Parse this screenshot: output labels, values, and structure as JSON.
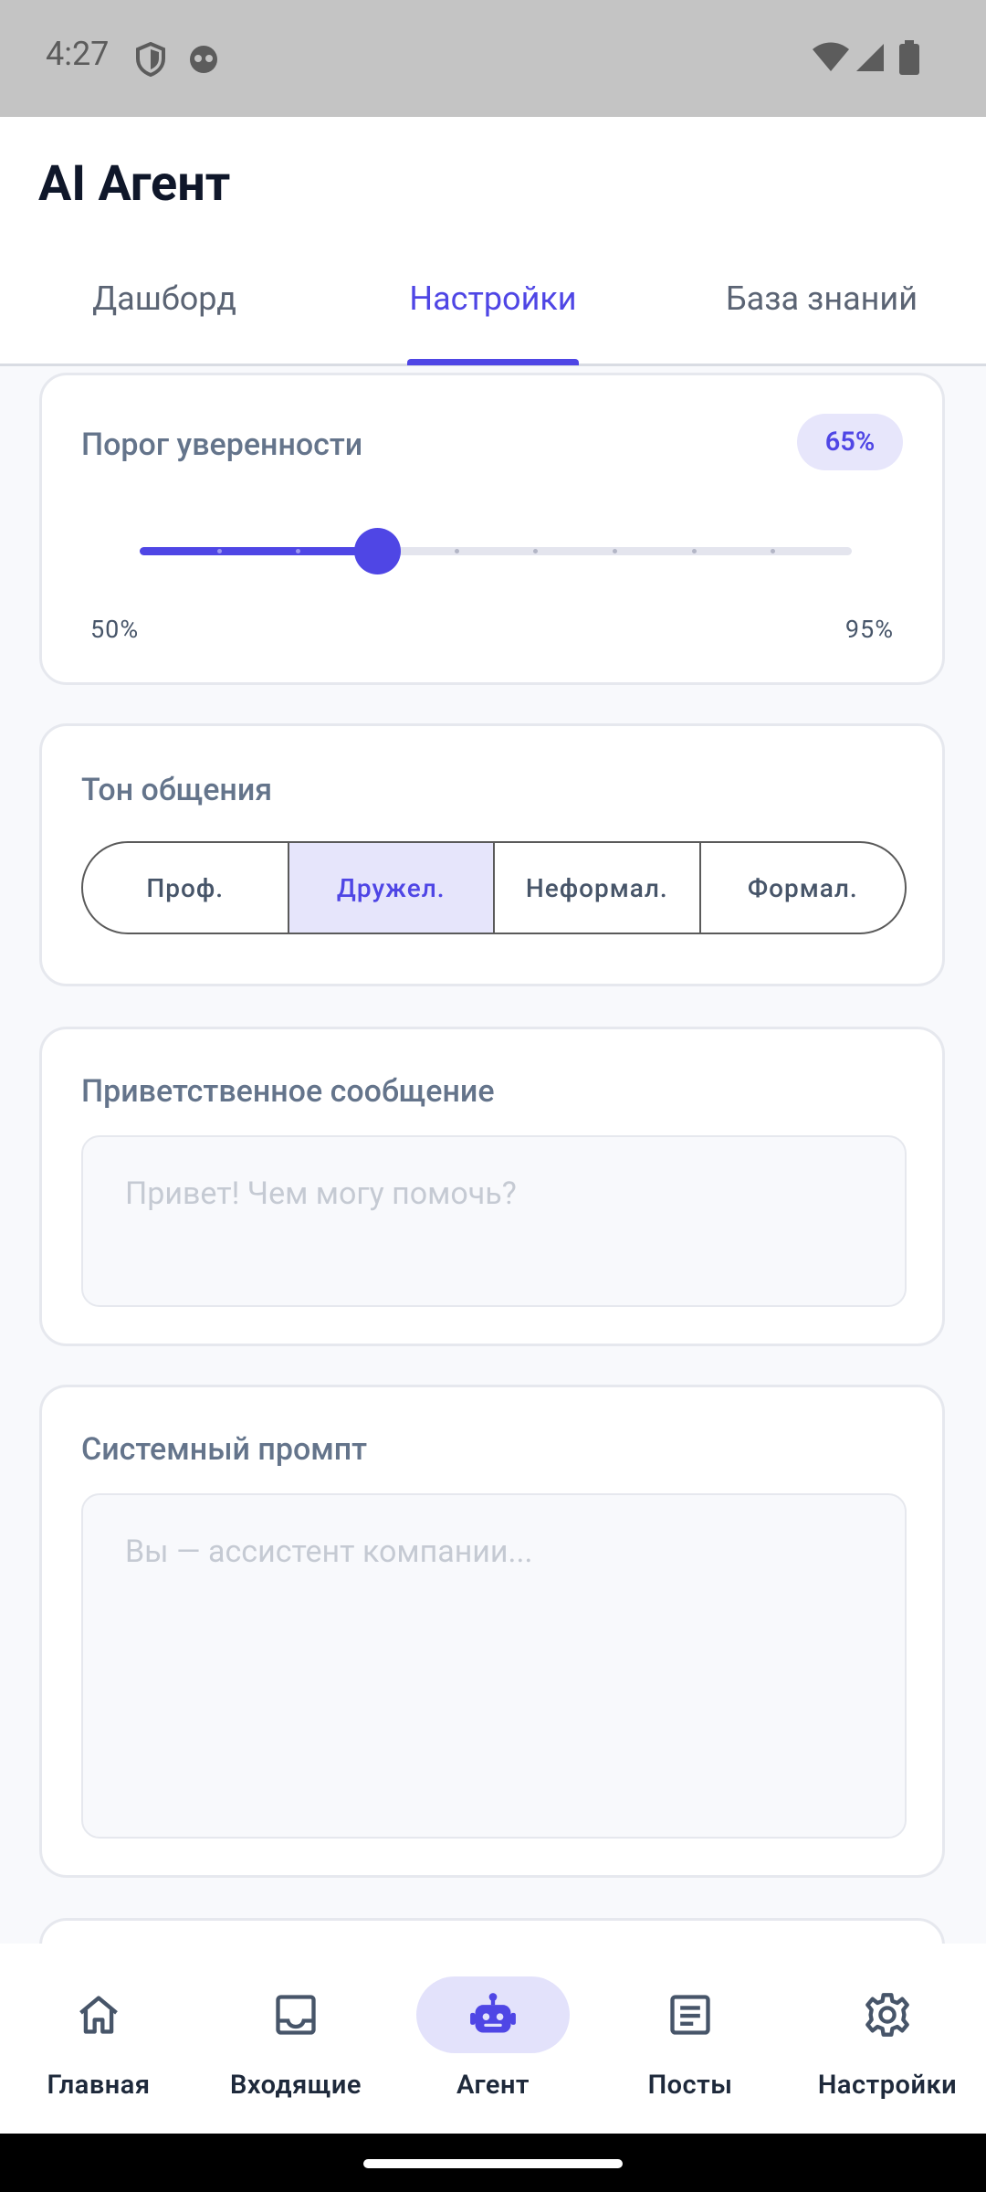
{
  "status_bar": {
    "time": "4:27"
  },
  "header": {
    "title": "AI Агент"
  },
  "tabs": [
    {
      "label": "Дашборд"
    },
    {
      "label": "Настройки"
    },
    {
      "label": "База знаний"
    }
  ],
  "confidence": {
    "label": "Порог уверенности",
    "value_text": "65%",
    "min_label": "50%",
    "max_label": "95%",
    "value_fraction": 0.333
  },
  "tone": {
    "label": "Тон общения",
    "options": [
      {
        "label": "Проф."
      },
      {
        "label": "Дружел."
      },
      {
        "label": "Неформал."
      },
      {
        "label": "Формал."
      }
    ],
    "selected": "Дружел."
  },
  "greeting": {
    "label": "Приветственное сообщение",
    "placeholder": "Привет! Чем могу помочь?"
  },
  "system_prompt": {
    "label": "Системный промпт",
    "placeholder": "Вы — ассистент компании..."
  },
  "bottom_nav": [
    {
      "label": "Главная",
      "icon": "home-icon"
    },
    {
      "label": "Входящие",
      "icon": "inbox-icon"
    },
    {
      "label": "Агент",
      "icon": "robot-icon"
    },
    {
      "label": "Посты",
      "icon": "article-icon"
    },
    {
      "label": "Настройки",
      "icon": "gear-icon"
    }
  ],
  "colors": {
    "accent": "#4f46e5",
    "accent_light": "#e6e5fb"
  }
}
